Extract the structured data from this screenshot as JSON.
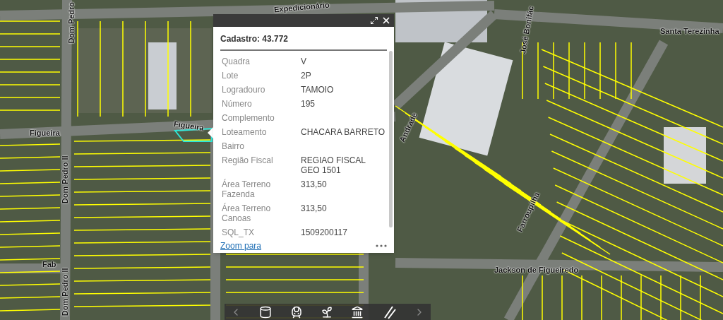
{
  "map": {
    "street_labels": [
      {
        "text": "Expedicionário"
      },
      {
        "text": "Dom Pedro"
      },
      {
        "text": "José Bonifác"
      },
      {
        "text": "Santa Terezinha"
      },
      {
        "text": "Figueira"
      },
      {
        "text": "Figueira"
      },
      {
        "text": "Dom Pedro II"
      },
      {
        "text": "Andrade"
      },
      {
        "text": "Farroupilha"
      },
      {
        "text": "Fab"
      },
      {
        "text": "Jackson de Figueiredo"
      },
      {
        "text": "Dom Pedro II"
      }
    ]
  },
  "popup": {
    "title": "Cadastro: 43.772",
    "fields": [
      {
        "label": "Quadra",
        "value": "V"
      },
      {
        "label": "Lote",
        "value": "2P"
      },
      {
        "label": "Logradouro",
        "value": "TAMOIO"
      },
      {
        "label": "Número",
        "value": "195"
      },
      {
        "label": "Complemento"
      },
      {
        "label": "Loteamento",
        "value": "CHACARA BARRETO"
      },
      {
        "label": "Bairro"
      },
      {
        "label": "Região Fiscal",
        "value": "REGIAO FISCAL GEO 1501"
      },
      {
        "label": "Área Terreno Fazenda",
        "value": "313,50"
      },
      {
        "label": "Área Terreno Canoas",
        "value": "313,50"
      },
      {
        "label": "SQL_TX",
        "value": "1509200117"
      }
    ],
    "footer_link": "Zoom para"
  }
}
